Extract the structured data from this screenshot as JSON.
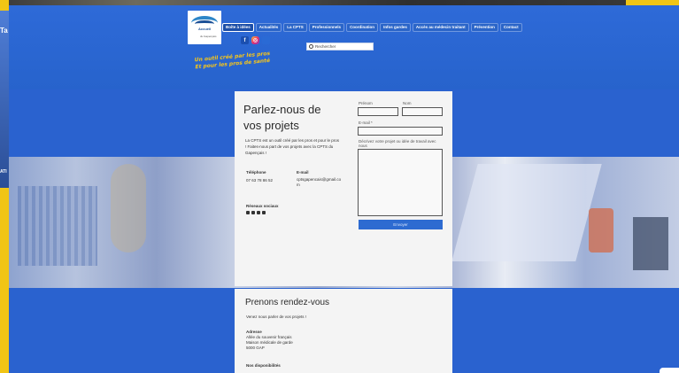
{
  "side": {
    "label_1": "Ta",
    "label_2": "ATI"
  },
  "header": {
    "logo_text": "Accueil",
    "logo_sub": "du Gapençais",
    "nav": [
      {
        "label": "Boîte à idées",
        "active": true
      },
      {
        "label": "Actualités"
      },
      {
        "label": "La CPTS"
      },
      {
        "label": "Professionnels"
      },
      {
        "label": "Coordination"
      },
      {
        "label": "Infos gardes"
      },
      {
        "label": "Accès au médecin traitant"
      },
      {
        "label": "Prévention"
      },
      {
        "label": "Contact"
      }
    ],
    "social": [
      "f",
      "◎",
      ""
    ],
    "search_placeholder": "Rechercher",
    "tagline_1": "Un outil créé par les pros",
    "tagline_2": "Et pour les pros de santé"
  },
  "contact": {
    "title": "Parlez-nous de vos projets",
    "description": "La CPTS est un outil créé par les pros et pour le pros ! Faites-nous part de vos projets avec la CPTS du Gapençais !",
    "phone_label": "Téléphone",
    "phone": "07 63 78 86 52",
    "email_label": "E-mail",
    "email": "cptsgapencais@gmail.com",
    "social_label": "Réseaux sociaux",
    "form": {
      "first_name_label": "Prénom",
      "last_name_label": "Nom",
      "email_label": "E-mail *",
      "project_label": "Décrivez votre projet ou idée de travail avec nous",
      "submit_label": "Envoyer"
    }
  },
  "appointment": {
    "title": "Prenons rendez-vous",
    "subtitle": "Venez nous parler de vos projets !",
    "address_label": "Adresse",
    "address_1": "Allée du souvenir français",
    "address_2": "Maison médicale de garde",
    "address_3": "5000 GAP",
    "availability_label": "Nos disponibilités"
  }
}
